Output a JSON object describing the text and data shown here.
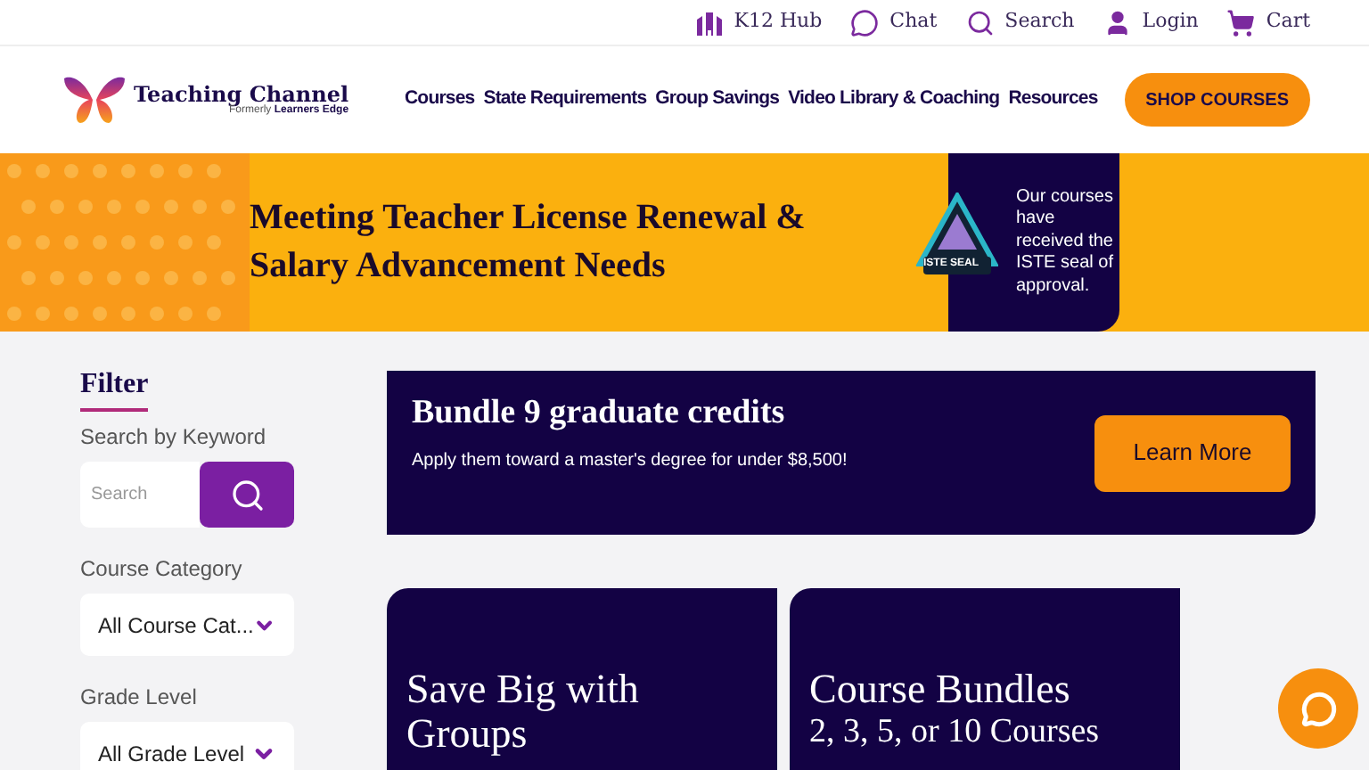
{
  "utility_bar": [
    {
      "kind": "hub",
      "label": "K12 Hub"
    },
    {
      "kind": "chat",
      "label": "Chat"
    },
    {
      "kind": "search",
      "label": "Search"
    },
    {
      "kind": "user",
      "label": "Login"
    },
    {
      "kind": "cart",
      "label": "Cart"
    }
  ],
  "logo": {
    "name": "Teaching Channel",
    "tagline_prefix": "Formerly",
    "tagline_brand": "Learners Edge"
  },
  "nav": [
    "Courses",
    "State Requirements",
    "Group Savings",
    "Video Library & Coaching",
    "Resources"
  ],
  "shop_button": "SHOP COURSES",
  "hero": {
    "headline": "Meeting Teacher License Renewal & Salary Advancement Needs",
    "seal_label": "ISTE SEAL",
    "seal_note": "Our courses have received the ISTE seal of approval."
  },
  "filter": {
    "title": "Filter",
    "keyword_label": "Search by Keyword",
    "search_placeholder": "Search",
    "dropdowns": [
      {
        "label": "Course Category",
        "value": "All Course Cat..."
      },
      {
        "label": "Grade Level",
        "value": "All Grade Level"
      }
    ]
  },
  "promo": {
    "title": "Bundle 9 graduate credits",
    "subtitle": "Apply them toward a master's degree for under $8,500!",
    "button": "Learn More"
  },
  "cards": [
    {
      "title": "Save Big with Groups"
    },
    {
      "title": "Course Bundles",
      "subtitle": "2, 3, 5, or 10 Courses"
    }
  ]
}
